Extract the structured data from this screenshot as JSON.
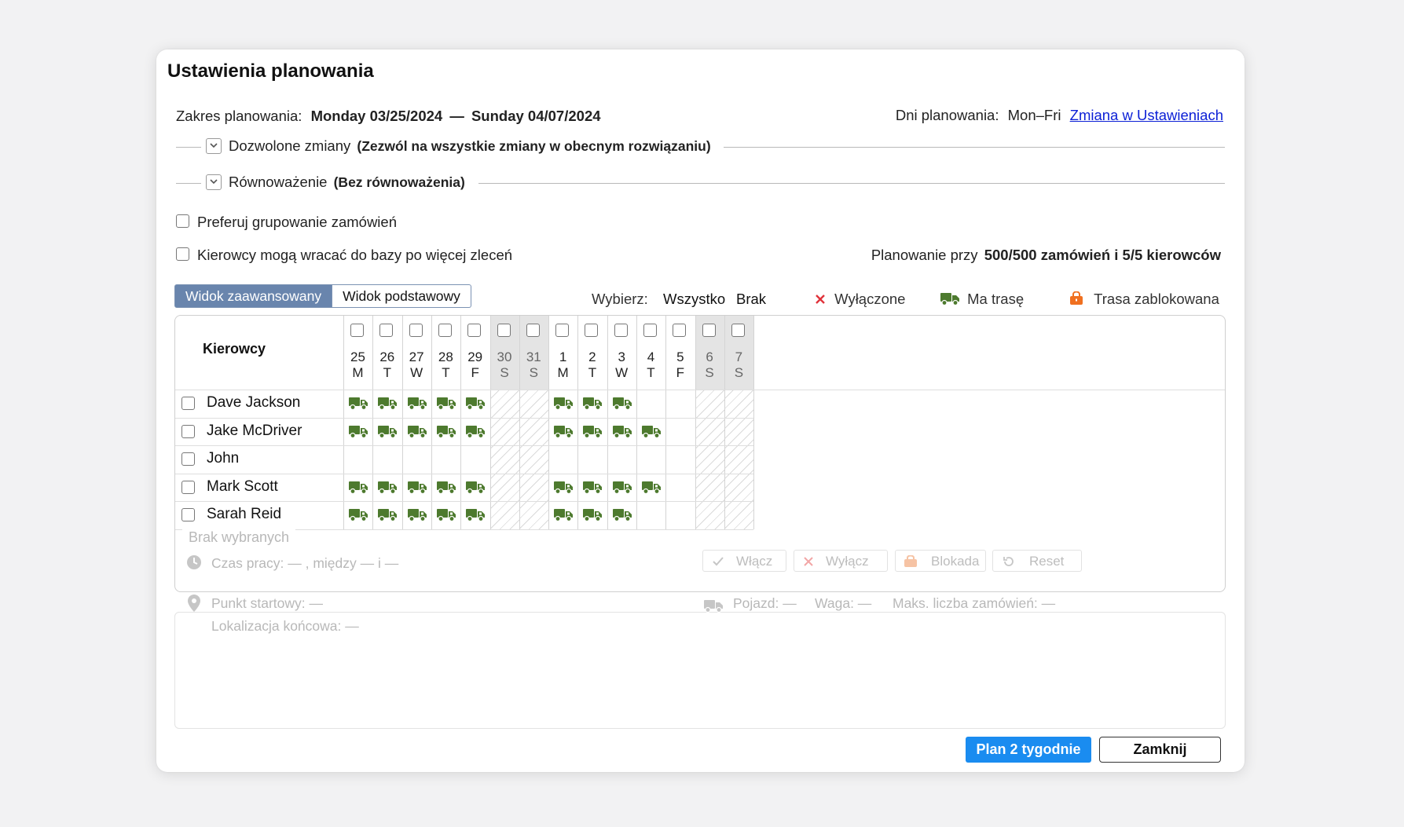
{
  "dialog": {
    "title": "Ustawienia planowania",
    "range_label": "Zakres planowania:",
    "range_start": "Monday 03/25/2024",
    "range_dash": "—",
    "range_end": "Sunday 04/07/2024",
    "days_label": "Dni planowania:",
    "days_value": "Mon–Fri",
    "days_link": "Zmiana w Ustawieniach"
  },
  "sections": {
    "allowed_label": "Dozwolone zmiany",
    "allowed_value": "(Zezwól na wszystkie zmiany w obecnym rozwiązaniu)",
    "balance_label": "Równoważenie",
    "balance_value": "(Bez równoważenia)"
  },
  "options": {
    "group_orders": "Preferuj grupowanie zamówień",
    "return_base": "Kierowcy mogą wracać do bazy po więcej zleceń",
    "planning_prefix": "Planowanie przy",
    "planning_value": "500/500 zamówień i 5/5 kierowców"
  },
  "tabs": {
    "advanced": "Widok zaawansowany",
    "basic": "Widok podstawowy"
  },
  "legend": {
    "select_label": "Wybierz:",
    "all": "Wszystko",
    "none": "Brak",
    "disabled": "Wyłączone",
    "has_route": "Ma trasę",
    "route_locked": "Trasa zablokowana",
    "colors": {
      "disabled": "#e0323a",
      "has_route": "#4d7a2e",
      "locked": "#f07020"
    }
  },
  "grid": {
    "drivers_header": "Kierowcy",
    "days": [
      {
        "num": "25",
        "letter": "M",
        "weekend": false
      },
      {
        "num": "26",
        "letter": "T",
        "weekend": false
      },
      {
        "num": "27",
        "letter": "W",
        "weekend": false
      },
      {
        "num": "28",
        "letter": "T",
        "weekend": false
      },
      {
        "num": "29",
        "letter": "F",
        "weekend": false
      },
      {
        "num": "30",
        "letter": "S",
        "weekend": true
      },
      {
        "num": "31",
        "letter": "S",
        "weekend": true
      },
      {
        "num": "1",
        "letter": "M",
        "weekend": false
      },
      {
        "num": "2",
        "letter": "T",
        "weekend": false
      },
      {
        "num": "3",
        "letter": "W",
        "weekend": false
      },
      {
        "num": "4",
        "letter": "T",
        "weekend": false
      },
      {
        "num": "5",
        "letter": "F",
        "weekend": false
      },
      {
        "num": "6",
        "letter": "S",
        "weekend": true
      },
      {
        "num": "7",
        "letter": "S",
        "weekend": true
      }
    ],
    "drivers": [
      {
        "name": "Dave Jackson",
        "routes": [
          1,
          1,
          1,
          1,
          1,
          0,
          0,
          1,
          1,
          1,
          0,
          0,
          0,
          0
        ]
      },
      {
        "name": "Jake McDriver",
        "routes": [
          1,
          1,
          1,
          1,
          1,
          0,
          0,
          1,
          1,
          1,
          1,
          0,
          0,
          0
        ]
      },
      {
        "name": "John",
        "routes": [
          0,
          0,
          0,
          0,
          0,
          0,
          0,
          0,
          0,
          0,
          0,
          0,
          0,
          0
        ]
      },
      {
        "name": "Mark Scott",
        "routes": [
          1,
          1,
          1,
          1,
          1,
          0,
          0,
          1,
          1,
          1,
          1,
          0,
          0,
          0
        ]
      },
      {
        "name": "Sarah Reid",
        "routes": [
          1,
          1,
          1,
          1,
          1,
          0,
          0,
          1,
          1,
          1,
          0,
          0,
          0,
          0
        ]
      }
    ]
  },
  "details": {
    "legend": "Brak wybranych",
    "work_time": "Czas pracy: — , między — i —",
    "start_point": "Punkt startowy: —",
    "end_location": "Lokalizacja końcowa: —",
    "vehicle": "Pojazd: —",
    "weight": "Waga: —",
    "max_orders": "Maks. liczba zamówień: —",
    "btn_enable": "Włącz",
    "btn_disable": "Wyłącz",
    "btn_block": "Blokada",
    "btn_reset": "Reset"
  },
  "footer": {
    "plan_button": "Plan 2 tygodnie",
    "close_button": "Zamknij"
  }
}
